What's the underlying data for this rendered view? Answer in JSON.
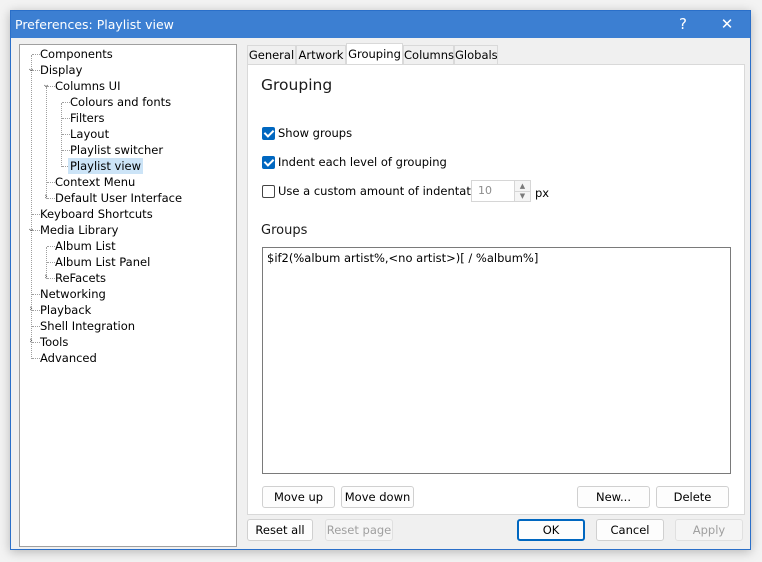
{
  "window": {
    "title": "Preferences: Playlist view",
    "help_glyph": "?",
    "close_glyph": "✕"
  },
  "tree": {
    "items": [
      {
        "label": "Components"
      },
      {
        "label": "Display"
      },
      {
        "label": "Columns UI"
      },
      {
        "label": "Colours and fonts"
      },
      {
        "label": "Filters"
      },
      {
        "label": "Layout"
      },
      {
        "label": "Playlist switcher"
      },
      {
        "label": "Playlist view"
      },
      {
        "label": "Context Menu"
      },
      {
        "label": "Default User Interface"
      },
      {
        "label": "Keyboard Shortcuts"
      },
      {
        "label": "Media Library"
      },
      {
        "label": "Album List"
      },
      {
        "label": "Album List Panel"
      },
      {
        "label": "ReFacets"
      },
      {
        "label": "Networking"
      },
      {
        "label": "Playback"
      },
      {
        "label": "Shell Integration"
      },
      {
        "label": "Tools"
      },
      {
        "label": "Advanced"
      }
    ],
    "expanded_glyph": "⌄",
    "collapsed_glyph": "›"
  },
  "tabs": [
    "General",
    "Artwork",
    "Grouping",
    "Columns",
    "Globals"
  ],
  "grouping": {
    "title": "Grouping",
    "show_groups_label": "Show groups",
    "show_groups_checked": true,
    "indent_label": "Indent each level of grouping",
    "indent_checked": true,
    "custom_indent_label": "Use a custom amount of indentation:",
    "custom_indent_checked": false,
    "indent_value": "10",
    "indent_unit": "px",
    "groups_heading": "Groups",
    "groups_text": "$if2(%album artist%,<no artist>)[ / %album%]",
    "move_up": "Move up",
    "move_down": "Move down",
    "new": "New...",
    "delete": "Delete"
  },
  "footer": {
    "reset_all": "Reset all",
    "reset_page": "Reset page",
    "ok": "OK",
    "cancel": "Cancel",
    "apply": "Apply"
  },
  "colors": {
    "title_bar": "#3c7fd2",
    "accent": "#0067c0",
    "selection": "#cce4f7"
  }
}
